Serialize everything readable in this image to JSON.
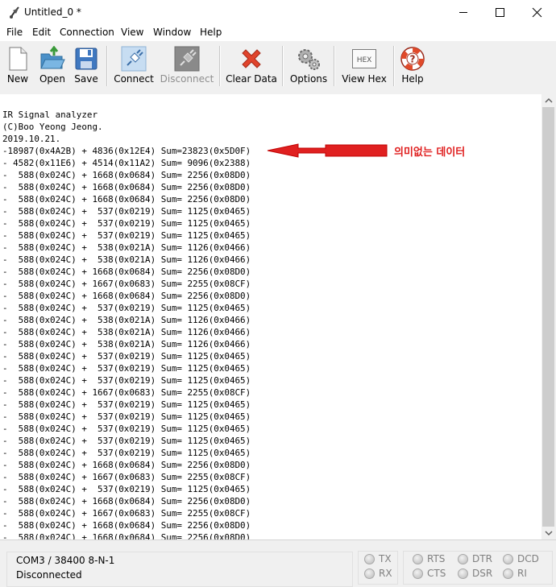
{
  "window": {
    "title": "Untitled_0 *"
  },
  "menu": [
    "File",
    "Edit",
    "Connection",
    "View",
    "Window",
    "Help"
  ],
  "toolbar": {
    "new": "New",
    "open": "Open",
    "save": "Save",
    "connect": "Connect",
    "disconnect": "Disconnect",
    "clear": "Clear Data",
    "options": "Options",
    "hex": "View Hex",
    "help": "Help",
    "hex_icon_text": "HEX"
  },
  "terminal": {
    "lines": [
      "IR Signal analyzer",
      "(C)Boo Yeong Jeong.",
      "2019.10.21.",
      "-18987(0x4A2B) + 4836(0x12E4) Sum=23823(0x5D0F)",
      "- 4582(0x11E6) + 4514(0x11A2) Sum= 9096(0x2388)",
      "-  588(0x024C) + 1668(0x0684) Sum= 2256(0x08D0)",
      "-  588(0x024C) + 1668(0x0684) Sum= 2256(0x08D0)",
      "-  588(0x024C) + 1668(0x0684) Sum= 2256(0x08D0)",
      "-  588(0x024C) +  537(0x0219) Sum= 1125(0x0465)",
      "-  588(0x024C) +  537(0x0219) Sum= 1125(0x0465)",
      "-  588(0x024C) +  537(0x0219) Sum= 1125(0x0465)",
      "-  588(0x024C) +  538(0x021A) Sum= 1126(0x0466)",
      "-  588(0x024C) +  538(0x021A) Sum= 1126(0x0466)",
      "-  588(0x024C) + 1668(0x0684) Sum= 2256(0x08D0)",
      "-  588(0x024C) + 1667(0x0683) Sum= 2255(0x08CF)",
      "-  588(0x024C) + 1668(0x0684) Sum= 2256(0x08D0)",
      "-  588(0x024C) +  537(0x0219) Sum= 1125(0x0465)",
      "-  588(0x024C) +  538(0x021A) Sum= 1126(0x0466)",
      "-  588(0x024C) +  538(0x021A) Sum= 1126(0x0466)",
      "-  588(0x024C) +  538(0x021A) Sum= 1126(0x0466)",
      "-  588(0x024C) +  537(0x0219) Sum= 1125(0x0465)",
      "-  588(0x024C) +  537(0x0219) Sum= 1125(0x0465)",
      "-  588(0x024C) +  537(0x0219) Sum= 1125(0x0465)",
      "-  588(0x024C) + 1667(0x0683) Sum= 2255(0x08CF)",
      "-  588(0x024C) +  537(0x0219) Sum= 1125(0x0465)",
      "-  588(0x024C) +  537(0x0219) Sum= 1125(0x0465)",
      "-  588(0x024C) +  537(0x0219) Sum= 1125(0x0465)",
      "-  588(0x024C) +  537(0x0219) Sum= 1125(0x0465)",
      "-  588(0x024C) +  537(0x0219) Sum= 1125(0x0465)",
      "-  588(0x024C) + 1668(0x0684) Sum= 2256(0x08D0)",
      "-  588(0x024C) + 1667(0x0683) Sum= 2255(0x08CF)",
      "-  588(0x024C) +  537(0x0219) Sum= 1125(0x0465)",
      "-  588(0x024C) + 1668(0x0684) Sum= 2256(0x08D0)",
      "-  588(0x024C) + 1667(0x0683) Sum= 2255(0x08CF)",
      "-  588(0x024C) + 1668(0x0684) Sum= 2256(0x08D0)",
      "-  588(0x024C) + 1668(0x0684) Sum= 2256(0x08D0)"
    ]
  },
  "annotation": {
    "text": "의미없는 데이터",
    "color": "#e02020"
  },
  "status": {
    "port": "COM3 / 38400 8-N-1",
    "state": "Disconnected",
    "signals": [
      "TX",
      "RX",
      "RTS",
      "CTS",
      "DTR",
      "DSR",
      "DCD",
      "RI"
    ]
  }
}
